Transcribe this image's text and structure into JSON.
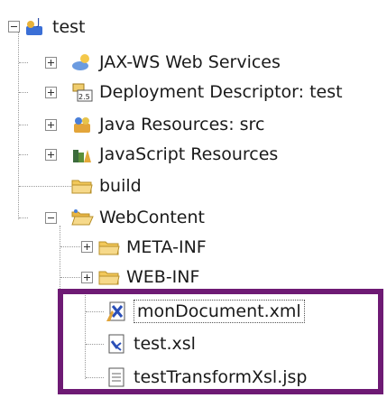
{
  "tree": {
    "root": {
      "label": "test",
      "icon": "java-ee-project-icon"
    },
    "items": [
      {
        "label": "JAX-WS Web Services",
        "icon": "web-services-icon"
      },
      {
        "label": "Deployment Descriptor: test",
        "icon": "deployment-descriptor-icon"
      },
      {
        "label": "Java Resources: src",
        "icon": "java-resources-icon"
      },
      {
        "label": "JavaScript Resources",
        "icon": "javascript-resources-icon"
      },
      {
        "label": "build",
        "icon": "folder-icon"
      },
      {
        "label": "WebContent",
        "icon": "folder-open-icon"
      },
      {
        "label": "META-INF",
        "icon": "folder-icon"
      },
      {
        "label": "WEB-INF",
        "icon": "folder-icon"
      },
      {
        "label": "monDocument.xml",
        "icon": "xml-file-icon"
      },
      {
        "label": "test.xsl",
        "icon": "xsl-file-icon"
      },
      {
        "label": "testTransformXsl.jsp",
        "icon": "jsp-file-icon"
      }
    ]
  },
  "colors": {
    "highlight_border": "#6e1a74",
    "folder": "#f2c85a"
  }
}
